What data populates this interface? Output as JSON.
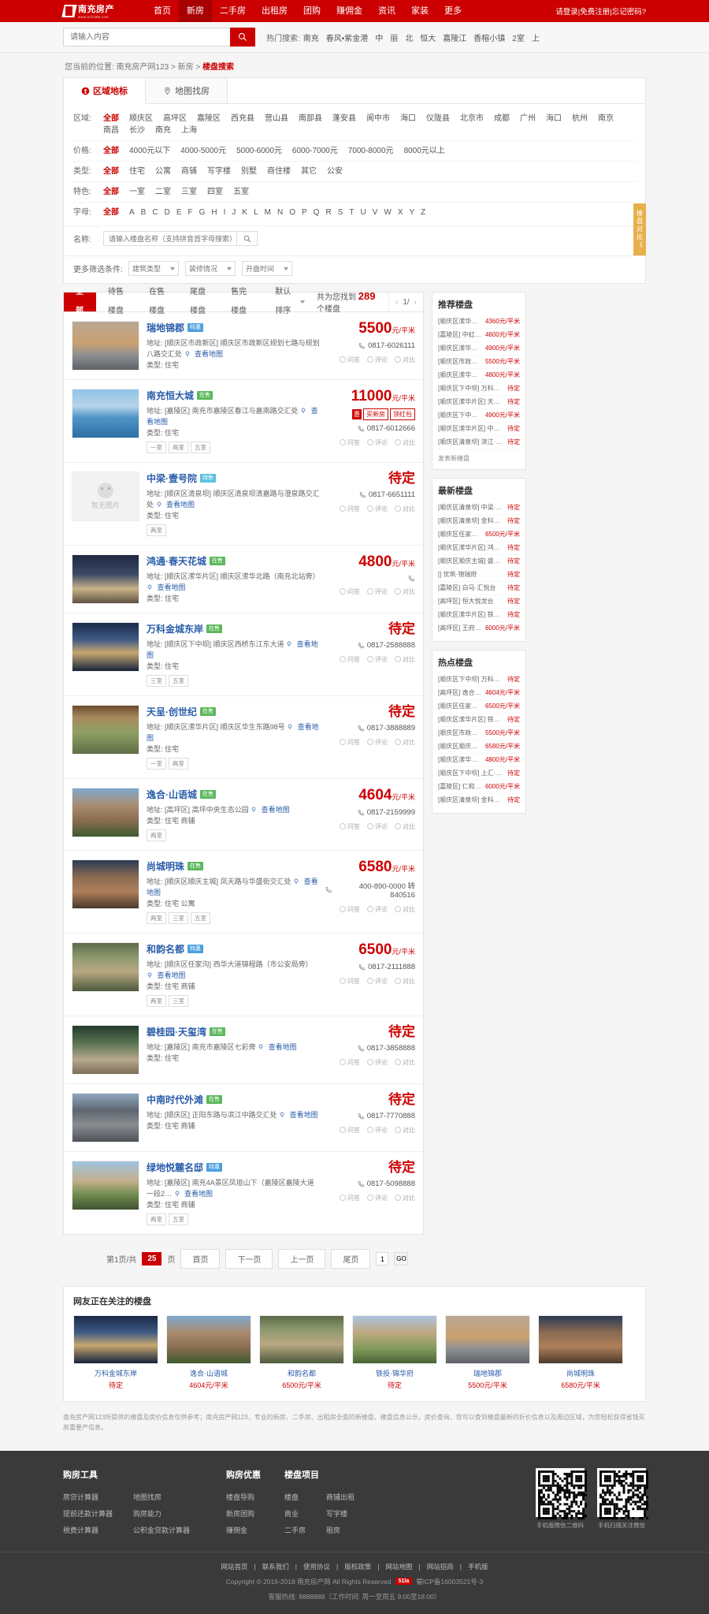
{
  "brand": {
    "name": "南充房产",
    "url": "www.scfc365.com",
    "accent": "#cc0000"
  },
  "nav": {
    "items": [
      {
        "label": "首页",
        "active": false
      },
      {
        "label": "新房",
        "active": true
      },
      {
        "label": "二手房",
        "active": false
      },
      {
        "label": "出租房",
        "active": false
      },
      {
        "label": "团购",
        "active": false
      },
      {
        "label": "赚佣金",
        "active": false
      },
      {
        "label": "资讯",
        "active": false
      },
      {
        "label": "家装",
        "active": false
      },
      {
        "label": "更多",
        "active": false
      }
    ],
    "user": {
      "login": "请登录",
      "register": "免费注册",
      "forgot": "忘记密码?",
      "sep": "|"
    }
  },
  "search": {
    "placeholder": "请输入内容",
    "value": "",
    "icon": "search-icon",
    "hot_label": "热门搜索:",
    "hot_items": [
      "南充",
      "春风•紫金港",
      "中",
      "丽",
      "北",
      "恒大",
      "嘉陵江",
      "香榕小镇",
      "2室",
      "上"
    ]
  },
  "breadcrumb": {
    "prefix": "您当前的位置:",
    "items": [
      "南充房产网123",
      "新房"
    ],
    "current": "楼盘搜索",
    "sep": ">"
  },
  "filter_tabs": [
    {
      "label": "区域地标",
      "icon": "location-pin-icon",
      "active": true
    },
    {
      "label": "地图找房",
      "icon": "map-icon",
      "active": false
    }
  ],
  "filters": [
    {
      "label": "区域:",
      "options": [
        "全部",
        "顺庆区",
        "高坪区",
        "嘉陵区",
        "西充县",
        "营山县",
        "南部县",
        "蓬安县",
        "阆中市",
        "海口",
        "仪陇县",
        "北京市",
        "成都",
        "广州",
        "海口",
        "杭州",
        "南京",
        "南昌",
        "长沙",
        "南充",
        "上海"
      ],
      "selected": "全部"
    },
    {
      "label": "价格:",
      "options": [
        "全部",
        "4000元以下",
        "4000-5000元",
        "5000-6000元",
        "6000-7000元",
        "7000-8000元",
        "8000元以上"
      ],
      "selected": "全部"
    },
    {
      "label": "类型:",
      "options": [
        "全部",
        "住宅",
        "公寓",
        "商铺",
        "写字楼",
        "别墅",
        "商住楼",
        "其它",
        "公安"
      ],
      "selected": "全部"
    },
    {
      "label": "特色:",
      "options": [
        "全部",
        "一室",
        "二室",
        "三室",
        "四室",
        "五室"
      ],
      "selected": "全部"
    },
    {
      "label": "字母:",
      "options": [
        "全部",
        "A",
        "B",
        "C",
        "D",
        "E",
        "F",
        "G",
        "H",
        "I",
        "J",
        "K",
        "L",
        "M",
        "N",
        "O",
        "P",
        "Q",
        "R",
        "S",
        "T",
        "U",
        "V",
        "W",
        "X",
        "Y",
        "Z"
      ],
      "selected": "全部"
    }
  ],
  "name_filter": {
    "label": "名称:",
    "placeholder": "请输入楼盘名称（支持拼音首字母搜索）",
    "value": "",
    "button_icon": "search-icon"
  },
  "more_filter": {
    "label": "更多筛选条件:",
    "selects": [
      {
        "value": "建筑类型",
        "icon": "chevron-down-icon"
      },
      {
        "value": "装修情况",
        "icon": "chevron-down-icon"
      },
      {
        "value": "开盘时间",
        "icon": "chevron-down-icon"
      }
    ]
  },
  "list_tabs": [
    {
      "label": "全部",
      "active": true
    },
    {
      "label": "待售楼盘",
      "active": false
    },
    {
      "label": "在售楼盘",
      "active": false
    },
    {
      "label": "尾盘楼盘",
      "active": false
    },
    {
      "label": "售完楼盘",
      "active": false
    }
  ],
  "sort": {
    "label": "默认排序",
    "icon": "chevron-down-icon"
  },
  "result_count": {
    "prefix": "共为您找到",
    "count": "289",
    "suffix": "个楼盘"
  },
  "list_pager": {
    "prev": "‹",
    "label": "1/",
    "next": "›"
  },
  "listings": [
    {
      "name": "瑞地锦郡",
      "tag": "特惠",
      "tag_color": "blue",
      "addr_label": "地址:",
      "district": "[顺庆区市政新区]",
      "address": "顺庆区市政新区规划七路与规划八路交汇处",
      "map_link": "查看地图",
      "type_label": "类型:",
      "type": "住宅",
      "rooms": [],
      "price": "5500",
      "unit": "元/平米",
      "is_tbd": false,
      "phone": "0817-6026111",
      "promo": null,
      "actions": [
        "问答",
        "评论",
        "对比"
      ],
      "img": "building-photo"
    },
    {
      "name": "南充恒大城",
      "tag": "在售",
      "tag_color": "green",
      "addr_label": "地址:",
      "district": "[嘉陵区]",
      "address": "南充市嘉陵区春江与嘉南路交汇处",
      "map_link": "查看地图",
      "type_label": "类型:",
      "type": "住宅",
      "rooms": [
        "一室",
        "两室",
        "五室"
      ],
      "price": "11000",
      "unit": "元/平米",
      "is_tbd": false,
      "phone": "0817-6012666",
      "promo": {
        "sq": "惠",
        "bd1": "买新房",
        "bd2": "领红包"
      },
      "actions": [
        "问答",
        "评论",
        "对比"
      ],
      "img": "lakeside-photo"
    },
    {
      "name": "中梁·壹号院",
      "tag": "待售",
      "tag_color": "lblue",
      "addr_label": "地址:",
      "district": "[顺庆区清泉坝]",
      "address": "顺庆区清泉坝清嘉路与澄泉路交汇处",
      "map_link": "查看地图",
      "type_label": "类型:",
      "type": "住宅",
      "rooms": [
        "两室"
      ],
      "price": "待定",
      "unit": "",
      "is_tbd": true,
      "phone": "0817-6651111",
      "promo": null,
      "actions": [
        "问答",
        "评论",
        "对比"
      ],
      "img": "no-image"
    },
    {
      "name": "鸿通·春天花城",
      "tag": "在售",
      "tag_color": "green",
      "addr_label": "地址:",
      "district": "[顺庆区潆华片区]",
      "address": "顺庆区潆华北路（南充北站旁）",
      "map_link": "查看地图",
      "type_label": "类型:",
      "type": "住宅",
      "rooms": [],
      "price": "4800",
      "unit": "元/平米",
      "is_tbd": false,
      "phone": "",
      "promo": null,
      "actions": [
        "问答",
        "评论",
        "对比"
      ],
      "img": "night-complex-photo"
    },
    {
      "name": "万科金城东岸",
      "tag": "在售",
      "tag_color": "green",
      "addr_label": "地址:",
      "district": "[顺庆区下中坝]",
      "address": "顺庆区西桥东江东大道",
      "map_link": "查看地图",
      "type_label": "类型:",
      "type": "住宅",
      "rooms": [
        "三室",
        "五室"
      ],
      "price": "待定",
      "unit": "",
      "is_tbd": true,
      "phone": "0817-2588888",
      "promo": null,
      "actions": [
        "问答",
        "评论",
        "对比"
      ],
      "img": "highrise-night-photo"
    },
    {
      "name": "天呈·创世纪",
      "tag": "在售",
      "tag_color": "green",
      "addr_label": "地址:",
      "district": "[顺庆区潆华片区]",
      "address": "顺庆区华生东路98号",
      "map_link": "查看地图",
      "type_label": "类型:",
      "type": "住宅",
      "rooms": [
        "一室",
        "两室"
      ],
      "price": "待定",
      "unit": "",
      "is_tbd": true,
      "phone": "0817-3888889",
      "promo": null,
      "actions": [
        "问答",
        "评论",
        "对比"
      ],
      "img": "villa-entrance-photo"
    },
    {
      "name": "逸合·山语城",
      "tag": "在售",
      "tag_color": "green",
      "addr_label": "地址:",
      "district": "[高坪区]",
      "address": "高坪中央生态公园",
      "map_link": "查看地图",
      "type_label": "类型:",
      "type": "住宅 商铺",
      "rooms": [
        "两室"
      ],
      "price": "4604",
      "unit": "元/平米",
      "is_tbd": false,
      "phone": "0817-2159999",
      "promo": null,
      "actions": [
        "问答",
        "评论",
        "对比"
      ],
      "img": "apartment-photo"
    },
    {
      "name": "尚城明珠",
      "tag": "在售",
      "tag_color": "green",
      "addr_label": "地址:",
      "district": "[顺庆区顺庆主城]",
      "address": "凤天路与华盛街交汇处",
      "map_link": "查看地图",
      "type_label": "类型:",
      "type": "住宅 公寓",
      "rooms": [
        "两室",
        "三室",
        "五室"
      ],
      "price": "6580",
      "unit": "元/平米",
      "is_tbd": false,
      "phone": "400-890-0000 转 840516",
      "promo": null,
      "actions": [
        "问答",
        "评论",
        "对比"
      ],
      "img": "street-shops-photo"
    },
    {
      "name": "和韵名都",
      "tag": "特惠",
      "tag_color": "blue",
      "addr_label": "地址:",
      "district": "[顺庆区任家沟]",
      "address": "西华大道锦程路（市公安局旁）",
      "map_link": "查看地图",
      "type_label": "类型:",
      "type": "住宅 商铺",
      "rooms": [
        "两室",
        "三室"
      ],
      "price": "6500",
      "unit": "元/平米",
      "is_tbd": false,
      "phone": "0817-2111888",
      "promo": null,
      "actions": [
        "问答",
        "评论",
        "对比"
      ],
      "img": "aerial-towers-photo"
    },
    {
      "name": "碧桂园·天玺湾",
      "tag": "在售",
      "tag_color": "green",
      "addr_label": "地址:",
      "district": "[嘉陵区]",
      "address": "南充市嘉陵区七彩旁",
      "map_link": "查看地图",
      "type_label": "类型:",
      "type": "住宅",
      "rooms": [],
      "price": "待定",
      "unit": "",
      "is_tbd": true,
      "phone": "0817-3858888",
      "promo": null,
      "actions": [
        "问答",
        "评论",
        "对比"
      ],
      "img": "lobby-photo"
    },
    {
      "name": "中南时代外滩",
      "tag": "在售",
      "tag_color": "green",
      "addr_label": "地址:",
      "district": "[顺庆区]",
      "address": "正阳东路与滨江中路交汇处",
      "map_link": "查看地图",
      "type_label": "类型:",
      "type": "住宅 商铺",
      "rooms": [],
      "price": "待定",
      "unit": "",
      "is_tbd": true,
      "phone": "0817-7770888",
      "promo": null,
      "actions": [
        "问答",
        "评论",
        "对比"
      ],
      "img": "tower-construction-photo"
    },
    {
      "name": "绿地悦麓名邸",
      "tag": "特惠",
      "tag_color": "blue",
      "addr_label": "地址:",
      "district": "[嘉陵区]",
      "address": "南充4A景区凤垭山下（嘉陵区嘉陵大道一段2…",
      "map_link": "查看地图",
      "type_label": "类型:",
      "type": "住宅 商铺",
      "rooms": [
        "两室",
        "五室"
      ],
      "price": "待定",
      "unit": "",
      "is_tbd": true,
      "phone": "0817-5098888",
      "promo": null,
      "actions": [
        "问答",
        "评论",
        "对比"
      ],
      "img": "villa-sunset-photo"
    }
  ],
  "sidebar": [
    {
      "title": "推荐楼盘",
      "rows": [
        {
          "name": "[顺庆区潆华片区] 芯外华府",
          "price": "4360元/平米"
        },
        {
          "name": "[嘉陵区] 中虹国际",
          "price": "4600元/平米"
        },
        {
          "name": "[顺庆区潆华片区] 锦绣城",
          "price": "4900元/平米"
        },
        {
          "name": "[顺庆区市政新区] 瑞地锦郡",
          "price": "5500元/平米"
        },
        {
          "name": "[顺庆区潆华片区] 鸿通·春天花城",
          "price": "4800元/平米"
        },
        {
          "name": "[顺庆区下中坝] 万科金城东岸",
          "price": "待定"
        },
        {
          "name": "[顺庆区潆华片区] 天呈·创世纪",
          "price": "待定"
        },
        {
          "name": "[顺庆区下中坝] 春风·紫金港",
          "price": "4900元/平米"
        },
        {
          "name": "[顺庆区潆华片区] 中泰·九号院",
          "price": "待定"
        },
        {
          "name": "[顺庆区清泉坝] 滨江·天之广场",
          "price": "待定"
        }
      ],
      "more": "发表新楼盘"
    },
    {
      "title": "最新楼盘",
      "rows": [
        {
          "name": "[顺庆区清泉坝] 中梁·壹号院",
          "price": "待定"
        },
        {
          "name": "[顺庆区清泉坝] 金科集美天宸",
          "price": "待定"
        },
        {
          "name": "[顺庆区任家沟] 和韵名都",
          "price": "6500元/平米"
        },
        {
          "name": "[顺庆区潆华片区] 鸿通南montage",
          "price": "待定"
        },
        {
          "name": "[顺庆区顺庆主城] 盛世华庭",
          "price": "待定"
        },
        {
          "name": "[] 优筑·锦瑞府",
          "price": "待定"
        },
        {
          "name": "[嘉陵区] 白马·汇悦台",
          "price": "待定"
        },
        {
          "name": "[高坪区] 恒大悦龙台",
          "price": "待定"
        },
        {
          "name": "[顺庆区潆华片区] 铁投·锦华府",
          "price": "待定"
        },
        {
          "name": "[高坪区] 王府井·锦州郡",
          "price": "6000元/平米"
        }
      ],
      "more": ""
    },
    {
      "title": "热点楼盘",
      "rows": [
        {
          "name": "[顺庆区下中坝] 万科金城东岸",
          "price": "待定"
        },
        {
          "name": "[高坪区] 逸合·山语城",
          "price": "4604元/平米"
        },
        {
          "name": "[顺庆区任家沟] 和韵名都",
          "price": "6500元/平米"
        },
        {
          "name": "[顺庆区潆华片区] 铁投·锦华府",
          "price": "待定"
        },
        {
          "name": "[顺庆区市政新区] 瑞地锦郡",
          "price": "5500元/平米"
        },
        {
          "name": "[顺庆区顺庆主城] 尚城明珠",
          "price": "6580元/平米"
        },
        {
          "name": "[顺庆区潆华片区] 鸿通·春天花城",
          "price": "4800元/平米"
        },
        {
          "name": "[顺庆区下中坝] 上汇·江语城",
          "price": "待定"
        },
        {
          "name": "[嘉陵区] 仁和国际",
          "price": "6000元/平米"
        },
        {
          "name": "[顺庆区清泉坝] 金科集美天宸",
          "price": "待定"
        }
      ],
      "more": ""
    }
  ],
  "compare_float": {
    "label": "楼盘对比",
    "arrow": "《"
  },
  "pagination": {
    "prefix": "第1页/共",
    "current": "25",
    "suffix": "页",
    "first": "首页",
    "next": "下一页",
    "prev": "上一页",
    "last": "尾页",
    "input": "1",
    "go": "GO"
  },
  "attention": {
    "title": "网友正在关注的楼盘",
    "cards": [
      {
        "name": "万科金城东岸",
        "price": "待定",
        "img": "highrise-night-photo"
      },
      {
        "name": "逸合·山语城",
        "price": "4604元/平米",
        "img": "apartment-photo"
      },
      {
        "name": "和韵名都",
        "price": "6500元/平米",
        "img": "aerial-towers-photo"
      },
      {
        "name": "铁投·锦华府",
        "price": "待定",
        "img": "garden-building-photo"
      },
      {
        "name": "瑞地锦郡",
        "price": "5500元/平米",
        "img": "building-photo"
      },
      {
        "name": "尚城明珠",
        "price": "6580元/平米",
        "img": "street-shops-photo"
      }
    ]
  },
  "seo_text": "南充房产网123所提供的楼盘及房价信息仅供参考；南充房产网123，专业的新房、二手房、出租房全面的新楼盘、楼盘信息公示，房价查询、您可以查到楼盘最新的折价信息以及周边区域，为您轻松获得省钱买房重要产信息。",
  "footer": {
    "groups": [
      {
        "title": "购房工具",
        "cols": [
          [
            "房贷计算器",
            "提前还款计算器",
            "税费计算器"
          ],
          [
            "地图找房",
            "购房能力",
            "公积金贷款计算器"
          ]
        ]
      },
      {
        "title": "购房优惠",
        "cols": [
          [
            "楼盘导购",
            "新房团购",
            "赚佣金"
          ]
        ]
      },
      {
        "title": "楼盘项目",
        "cols": [
          [
            "楼盘",
            "商业",
            "二手房"
          ],
          [
            "商铺出租",
            "写字楼",
            "租房"
          ]
        ]
      }
    ],
    "qr": [
      {
        "caption": "手机版微信二维码"
      },
      {
        "caption": "手机扫描关注微信"
      }
    ],
    "links": [
      "网站首页",
      "联系我们",
      "使用协议",
      "版权政策",
      "网站地图",
      "网站招商",
      "手机版"
    ],
    "copyright": "Copyright © 2016-2018 南充房产网 All Rights Reserved",
    "badge": "51la",
    "icp": "蜀ICP备16003521号-3",
    "hotline": "客服热线: 8888888（工作时间: 周一至周五 9:00至18:00）"
  }
}
